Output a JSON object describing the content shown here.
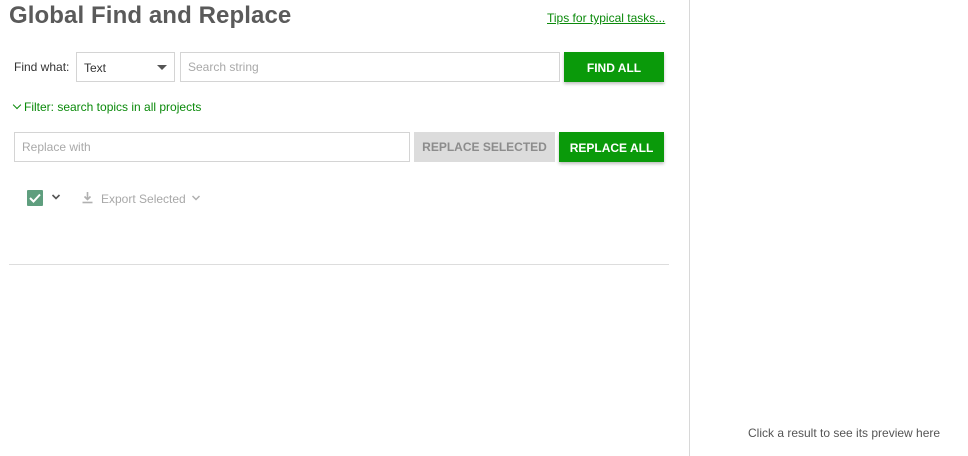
{
  "header": {
    "title": "Global Find and Replace",
    "tips_link": "Tips for typical tasks..."
  },
  "find": {
    "label": "Find what:",
    "type_selected": "Text",
    "search_placeholder": "Search string",
    "search_value": "",
    "find_all_label": "FIND ALL"
  },
  "filter": {
    "label": "Filter: search topics in all projects"
  },
  "replace": {
    "placeholder": "Replace with",
    "value": "",
    "replace_selected_label": "REPLACE SELECTED",
    "replace_all_label": "REPLACE ALL"
  },
  "results_toolbar": {
    "select_all_checked": true,
    "export_label": "Export Selected"
  },
  "preview": {
    "hint": "Click a result to see its preview here"
  },
  "colors": {
    "accent_green": "#0a9a0a",
    "link_green": "#0b8a0b",
    "checkbox_green": "#5f9e7e",
    "disabled_button": "#dcdcdc",
    "title_gray": "#5a5a5a"
  },
  "icons": {
    "type_dropdown": "caret-down-icon",
    "filter_toggle": "chevron-down-icon",
    "select_all": "checkbox-checked-icon",
    "select_menu": "chevron-down-icon",
    "export": "download-icon"
  }
}
